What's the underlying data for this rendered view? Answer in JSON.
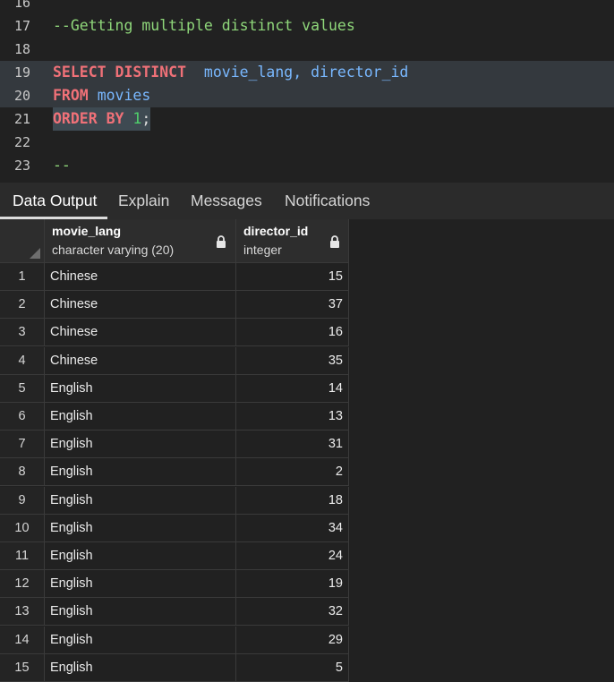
{
  "editor": {
    "lines": [
      {
        "n": "16",
        "text": ""
      },
      {
        "n": "17",
        "text": "--Getting multiple distinct values"
      },
      {
        "n": "18",
        "text": ""
      },
      {
        "n": "19",
        "kw1": "SELECT DISTINCT",
        "cols": "movie_lang, director_id"
      },
      {
        "n": "20",
        "kw1": "FROM",
        "cols": "movies"
      },
      {
        "n": "21",
        "kw1": "ORDER BY",
        "num": "1",
        "end": ";"
      },
      {
        "n": "22",
        "text": ""
      },
      {
        "n": "23",
        "text": "--"
      }
    ]
  },
  "tabs": [
    "Data Output",
    "Explain",
    "Messages",
    "Notifications"
  ],
  "grid": {
    "columns": [
      {
        "name": "movie_lang",
        "type": "character varying (20)"
      },
      {
        "name": "director_id",
        "type": "integer"
      }
    ],
    "rows": [
      {
        "n": "1",
        "lang": "Chinese",
        "dir": "15"
      },
      {
        "n": "2",
        "lang": "Chinese",
        "dir": "37"
      },
      {
        "n": "3",
        "lang": "Chinese",
        "dir": "16"
      },
      {
        "n": "4",
        "lang": "Chinese",
        "dir": "35"
      },
      {
        "n": "5",
        "lang": "English",
        "dir": "14"
      },
      {
        "n": "6",
        "lang": "English",
        "dir": "13"
      },
      {
        "n": "7",
        "lang": "English",
        "dir": "31"
      },
      {
        "n": "8",
        "lang": "English",
        "dir": "2"
      },
      {
        "n": "9",
        "lang": "English",
        "dir": "18"
      },
      {
        "n": "10",
        "lang": "English",
        "dir": "34"
      },
      {
        "n": "11",
        "lang": "English",
        "dir": "24"
      },
      {
        "n": "12",
        "lang": "English",
        "dir": "19"
      },
      {
        "n": "13",
        "lang": "English",
        "dir": "32"
      },
      {
        "n": "14",
        "lang": "English",
        "dir": "29"
      },
      {
        "n": "15",
        "lang": "English",
        "dir": "5"
      }
    ]
  }
}
